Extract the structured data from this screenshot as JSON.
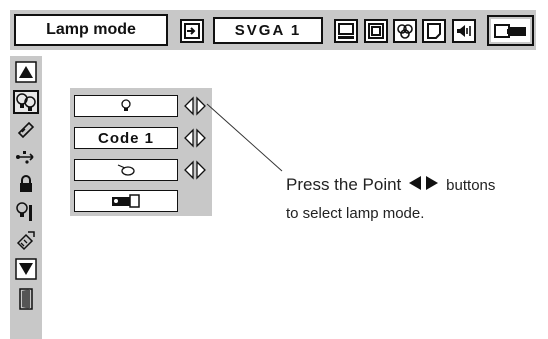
{
  "menu": {
    "title": "Lamp mode",
    "signal": "SVGA 1",
    "toolbar_icons": [
      "input-icon",
      "monitor-icon",
      "screen-icon",
      "color-icon",
      "setting-icon",
      "sound-icon",
      "projector-icon"
    ]
  },
  "sidebar": {
    "icons": [
      "up-arrow-icon",
      "lamp-mode-icon",
      "remote-code-icon",
      "usb-icon",
      "lock-icon",
      "lamp-timer-icon",
      "filter-icon",
      "down-arrow-icon",
      "exit-door-icon"
    ],
    "selected": "lamp-mode-icon"
  },
  "panel": {
    "row1_icon": "bulb-icon",
    "row2_value": "Code 1",
    "row3_icon": "mouse-icon",
    "row4_icon": "projector-icon"
  },
  "note": {
    "line1_prefix": "Press the Point ",
    "line1_suffix": " buttons",
    "line2": "to select lamp mode."
  }
}
